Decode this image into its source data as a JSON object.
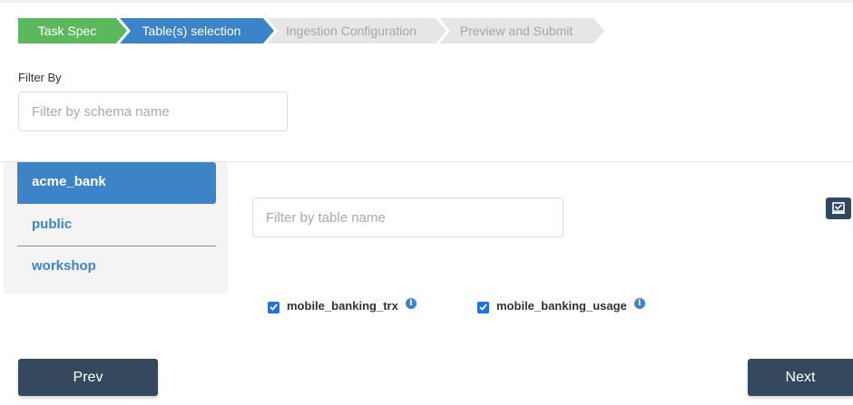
{
  "wizard": {
    "steps": [
      {
        "label": "Task Spec",
        "state": "done"
      },
      {
        "label": "Table(s) selection",
        "state": "active"
      },
      {
        "label": "Ingestion Configuration",
        "state": "pending"
      },
      {
        "label": "Preview and Submit",
        "state": "pending"
      }
    ]
  },
  "filter": {
    "label": "Filter By",
    "schema_placeholder": "Filter by schema name",
    "table_placeholder": "Filter by table name"
  },
  "schemas": [
    {
      "label": "acme_bank",
      "selected": true
    },
    {
      "label": "public",
      "selected": false
    },
    {
      "label": "workshop",
      "selected": false
    }
  ],
  "tables": [
    {
      "label": "mobile_banking_trx",
      "checked": true,
      "info_icon": "info-icon"
    },
    {
      "label": "mobile_banking_usage",
      "checked": true,
      "info_icon": "info-icon"
    }
  ],
  "select_all_icon": "select-all-icon",
  "buttons": {
    "prev": "Prev",
    "next": "Next"
  },
  "colors": {
    "step_done": "#5cb85c",
    "step_active": "#3c84c7",
    "step_pending": "#e6e6e6",
    "button_dark": "#34495e",
    "checkbox": "#1a73e8"
  }
}
